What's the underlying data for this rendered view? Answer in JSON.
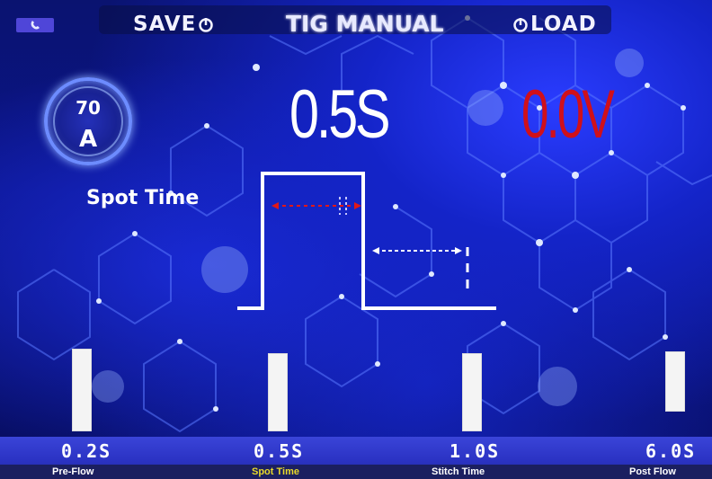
{
  "header": {
    "save_label": "SAVE",
    "title": "TIG MANUAL",
    "load_label": "LOAD"
  },
  "icons": {
    "phone": "phone-icon",
    "save_power": "power-icon",
    "load_power": "power-icon"
  },
  "current": {
    "value": "70",
    "unit": "A"
  },
  "selected_param": "Spot Time",
  "display": {
    "time": "0.5S",
    "voltage": "0.0V"
  },
  "params": [
    {
      "value": "0.2S",
      "label": "Pre-Flow",
      "active": false,
      "level": 0.66
    },
    {
      "value": "0.5S",
      "label": "Spot Time",
      "active": true,
      "level": 0.62
    },
    {
      "value": "1.0S",
      "label": "Stitch Time",
      "active": false,
      "level": 0.62
    },
    {
      "value": "6.0S",
      "label": "Post Flow",
      "active": false,
      "level": 0.48
    }
  ],
  "colors": {
    "background": "#0b148a",
    "voltage": "#d0101a",
    "active_label": "#e8d92a",
    "waveform": "#ffffff",
    "spot_arrow": "#e01818"
  }
}
